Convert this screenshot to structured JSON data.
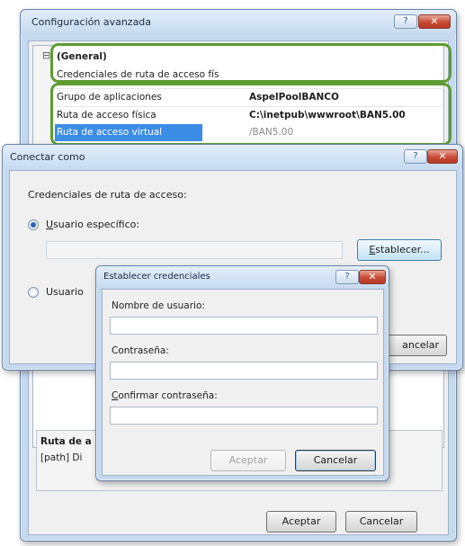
{
  "back_window": {
    "title": "Configuración avanzada",
    "help_glyph": "?",
    "close_glyph": "✕",
    "expander_glyph": "⊟",
    "section_title": "(General)",
    "credentials_row_label": "Credenciales de ruta de acceso fís",
    "rows": [
      {
        "name": "Grupo de aplicaciones",
        "value": "AspelPoolBANCO"
      },
      {
        "name": "Ruta de acceso física",
        "value": "C:\\inetpub\\wwwroot\\BAN5.00"
      },
      {
        "name": "Ruta de acceso virtual",
        "value": "/BAN5.00"
      }
    ],
    "desc_title": "Ruta de a",
    "desc_text": "[path] Di",
    "ok_label": "Aceptar",
    "cancel_label": "Cancelar"
  },
  "connect_as": {
    "title": "Conectar como",
    "help_glyph": "?",
    "close_glyph": "✕",
    "heading": "Credenciales de ruta de acceso:",
    "specific_user_first": "U",
    "specific_user_rest": "suario específico:",
    "set_first": "E",
    "set_rest": "stablecer...",
    "app_user_label": "Usuario",
    "cancel_partial": "ancelar"
  },
  "set_credentials": {
    "title": "Establecer credenciales",
    "help_glyph": "?",
    "close_glyph": "✕",
    "username_label": "Nombre de usuario:",
    "password_label": "Contraseña:",
    "confirm_first": "C",
    "confirm_rest": "onfirmar contraseña:",
    "username_value": "",
    "password_value": "",
    "confirm_value": "",
    "ok_label": "Aceptar",
    "cancel_label": "Cancelar"
  }
}
